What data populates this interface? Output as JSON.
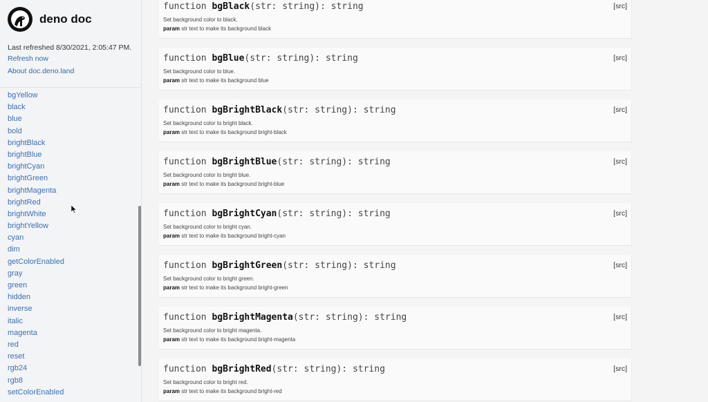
{
  "sidebar": {
    "title": "deno doc",
    "refresh_prefix": "Last refreshed 8/30/2021, 2:05:47 PM.",
    "refresh_link": "Refresh now",
    "about_link": "About doc.deno.land",
    "items": [
      "bgYellow",
      "black",
      "blue",
      "bold",
      "brightBlack",
      "brightBlue",
      "brightCyan",
      "brightGreen",
      "brightMagenta",
      "brightRed",
      "brightWhite",
      "brightYellow",
      "cyan",
      "dim",
      "getColorEnabled",
      "gray",
      "green",
      "hidden",
      "inverse",
      "italic",
      "magenta",
      "red",
      "reset",
      "rgb24",
      "rgb8",
      "setColorEnabled"
    ]
  },
  "main": {
    "keyword": "function",
    "src_label": "[src]",
    "param_keyword": "param",
    "cards": [
      {
        "name": "bgBlack",
        "sig_rest": "(str: string): string",
        "description": "Set background color to black.",
        "param_text": "str text to make its background black"
      },
      {
        "name": "bgBlue",
        "sig_rest": "(str: string): string",
        "description": "Set background color to blue.",
        "param_text": "str text to make its background blue"
      },
      {
        "name": "bgBrightBlack",
        "sig_rest": "(str: string): string",
        "description": "Set background color to bright black.",
        "param_text": "str text to make its background bright-black"
      },
      {
        "name": "bgBrightBlue",
        "sig_rest": "(str: string): string",
        "description": "Set background color to bright blue.",
        "param_text": "str text to make its background bright-blue"
      },
      {
        "name": "bgBrightCyan",
        "sig_rest": "(str: string): string",
        "description": "Set background color to bright cyan.",
        "param_text": "str text to make its background bright-cyan"
      },
      {
        "name": "bgBrightGreen",
        "sig_rest": "(str: string): string",
        "description": "Set background color to bright green.",
        "param_text": "str text to make its background bright-green"
      },
      {
        "name": "bgBrightMagenta",
        "sig_rest": "(str: string): string",
        "description": "Set background color to bright magenta.",
        "param_text": "str text to make its background bright-magenta"
      },
      {
        "name": "bgBrightRed",
        "sig_rest": "(str: string): string",
        "description": "Set background color to bright red.",
        "param_text": "str text to make its background bright-red"
      }
    ]
  },
  "colors": {
    "link": "#2b6cb0",
    "nav_link": "#3b6fb5",
    "background": "#f4f4f5"
  },
  "icons": {
    "logo": "deno-logo-icon",
    "cursor": "mouse-cursor-icon"
  }
}
